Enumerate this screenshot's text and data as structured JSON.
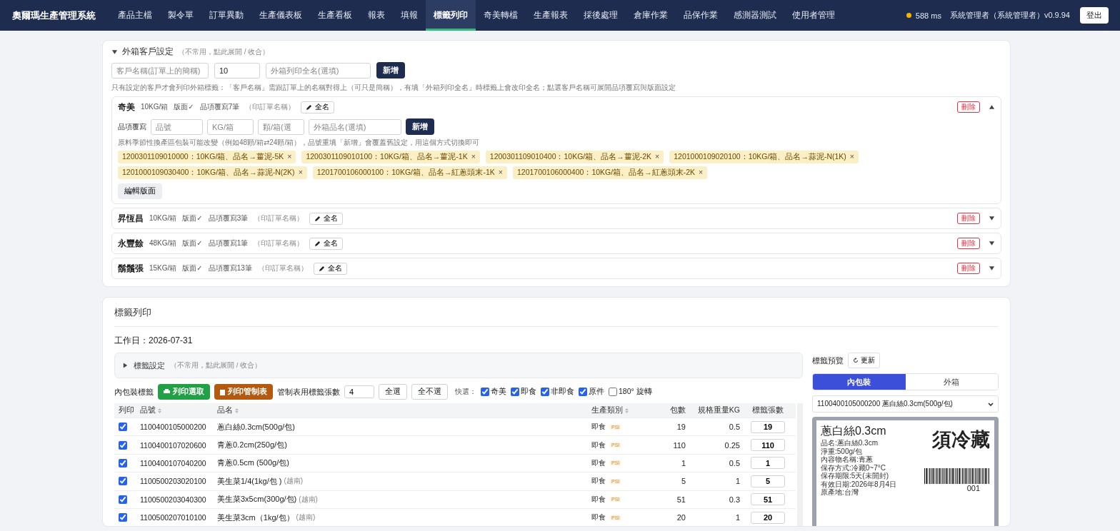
{
  "app": {
    "title": "奧爾瑪生產管理系統"
  },
  "nav": [
    {
      "label": "產品主檔",
      "selected": false
    },
    {
      "label": "製令單",
      "selected": false
    },
    {
      "label": "訂單異動",
      "selected": false
    },
    {
      "label": "生產儀表板",
      "selected": false
    },
    {
      "label": "生產看板",
      "selected": false
    },
    {
      "label": "報表",
      "selected": false
    },
    {
      "label": "填報",
      "selected": false
    },
    {
      "label": "標籤列印",
      "selected": true
    },
    {
      "label": "奇美轉檔",
      "selected": false
    },
    {
      "label": "生產報表",
      "selected": false
    },
    {
      "label": "採後處理",
      "selected": false
    },
    {
      "label": "倉庫作業",
      "selected": false
    },
    {
      "label": "品保作業",
      "selected": false
    },
    {
      "label": "感測器測試",
      "selected": false
    },
    {
      "label": "使用者管理",
      "selected": false
    }
  ],
  "status": {
    "latency": "588 ms",
    "color": "#f5b400",
    "user": "系統管理者（系統管理者）v0.9.94",
    "logout": "登出"
  },
  "carton_settings": {
    "expanded": true,
    "title": "外箱客戶設定",
    "hint": "（不常用，點此展開 / 收合）",
    "fields": [
      {
        "placeholder": "客戶名稱(訂單上的簡稱)"
      },
      {
        "value": "10"
      },
      {
        "placeholder": "外箱列印全名(選填)"
      }
    ],
    "add_button": "新增",
    "note": "只有設定的客戶才會列印外箱標籤：「客戶名稱」需跟訂單上的名稱對得上（可只是簡稱），有填「外箱列印全名」時標籤上會改印全名；點選客戶名稱可展開品項覆寫與版面設定",
    "customers": [
      {
        "name": "奇美",
        "weight": "10KG/箱",
        "layout": "版面✓",
        "overrides": "品項覆寫7筆",
        "print_name": "（印訂單名稱）",
        "fullname_button": "全名",
        "delete_button": "刪除",
        "expanded": true,
        "override_label": "品項覆寫",
        "override_fields": [
          {
            "placeholder": "品號"
          },
          {
            "placeholder": "KG/箱"
          },
          {
            "placeholder": "顆/箱(選"
          },
          {
            "placeholder": "外箱品名(選填)"
          }
        ],
        "add_button": "新增",
        "note": "原料季節性換產區包裝可能改變（例如48顆/箱⇄24顆/箱），品號重填「新增」會覆蓋舊設定，用這個方式切換即可",
        "chips": [
          {
            "text": "1200301109010000：10KG/箱、品名→薑泥-5K",
            "remove": "×"
          },
          {
            "text": "1200301109010100：10KG/箱、品名→薑泥-1K",
            "remove": "×"
          },
          {
            "text": "1200301109010400：10KG/箱、品名→薑泥-2K",
            "remove": "×"
          },
          {
            "text": "1201000109020100：10KG/箱、品名→蒜泥-N(1K)",
            "remove": "×"
          },
          {
            "text": "1201000109030400：10KG/箱、品名→蒜泥-N(2K)",
            "remove": "×"
          },
          {
            "text": "1201700106000100：10KG/箱、品名→紅蔥頭末-1K",
            "remove": "×"
          },
          {
            "text": "1201700106000400：10KG/箱、品名→紅蔥頭末-2K",
            "remove": "×"
          }
        ],
        "edit_layout_button": "編輯版面"
      },
      {
        "name": "昇恆昌",
        "weight": "10KG/箱",
        "layout": "版面✓",
        "overrides": "品項覆寫3筆",
        "print_name": "（印訂單名稱）",
        "fullname_button": "全名",
        "delete_button": "刪除",
        "expanded": false
      },
      {
        "name": "永豐餘",
        "weight": "48KG/箱",
        "layout": "版面✓",
        "overrides": "品項覆寫1筆",
        "print_name": "（印訂單名稱）",
        "fullname_button": "全名",
        "delete_button": "刪除",
        "expanded": false
      },
      {
        "name": "鬍鬚張",
        "weight": "15KG/箱",
        "layout": "版面✓",
        "overrides": "品項覆寫13筆",
        "print_name": "（印訂單名稱）",
        "fullname_button": "全名",
        "delete_button": "刪除",
        "expanded": false
      }
    ]
  },
  "label_print": {
    "title": "標籤列印",
    "work_date": "工作日：2026-07-31",
    "settings": {
      "expanded": false,
      "title": "標籤設定",
      "hint": "（不常用，點此展開 / 收合）"
    },
    "toolbar": {
      "label": "內包裝標籤",
      "print_selected": "列印選取",
      "print_control": "列印管制表",
      "count_label": "管制表用標籤張數",
      "count_value": "4",
      "select_all": "全選",
      "select_none": "全不選",
      "quick_label": "快選：",
      "filters": [
        {
          "label": "奇美",
          "checked": true
        },
        {
          "label": "即食",
          "checked": true
        },
        {
          "label": "非即食",
          "checked": true
        },
        {
          "label": "原件",
          "checked": true
        }
      ],
      "rotate": {
        "label": "180° 旋轉",
        "checked": false
      }
    },
    "table": {
      "columns": [
        {
          "label": "列印",
          "sortable": false
        },
        {
          "label": "品號",
          "sortable": true
        },
        {
          "label": "品名",
          "sortable": true
        },
        {
          "label": "生產類別",
          "sortable": true
        },
        {
          "label": "包數",
          "sortable": false
        },
        {
          "label": "規格重量KG",
          "sortable": false
        },
        {
          "label": "標籤張數",
          "sortable": false
        }
      ],
      "rows": [
        {
          "print": true,
          "code": "1100400105000200",
          "name": "蔥白絲0.3cm(500g/包)",
          "category": "即食",
          "tag": "PSI",
          "packs": "19",
          "weight": "0.5",
          "count": "19"
        },
        {
          "print": true,
          "code": "1100400107020600",
          "name": "青蔥0.2cm(250g/包)",
          "category": "即食",
          "tag": "PSI",
          "packs": "110",
          "weight": "0.25",
          "count": "110"
        },
        {
          "print": true,
          "code": "1100400107040200",
          "name": "青蔥0.5cm (500g/包)",
          "category": "即食",
          "tag": "PSI",
          "packs": "1",
          "weight": "0.5",
          "count": "1"
        },
        {
          "print": true,
          "code": "1100500203020100",
          "name": "美生菜1/4(1kg/包 )",
          "origin": "(越南)",
          "category": "即食",
          "tag": "PSI",
          "packs": "5",
          "weight": "1",
          "count": "5"
        },
        {
          "print": true,
          "code": "1100500203040300",
          "name": "美生菜3x5cm(300g/包)",
          "origin": "(越南)",
          "category": "即食",
          "tag": "PSI",
          "packs": "51",
          "weight": "0.3",
          "count": "51"
        },
        {
          "print": true,
          "code": "1100500207010100",
          "name": "美生菜3cm（1kg/包）",
          "origin": "(越南)",
          "category": "即食",
          "tag": "PSI",
          "packs": "20",
          "weight": "1",
          "count": "20"
        }
      ]
    }
  },
  "preview": {
    "title": "標籤預覽",
    "refresh": "更新",
    "tabs": [
      {
        "label": "內包裝",
        "selected": true
      },
      {
        "label": "外箱",
        "selected": false
      }
    ],
    "select_value": "1100400105000200 蔥白絲0.3cm(500g/包)",
    "label": {
      "name": "蔥白絲0.3cm",
      "lines": [
        "品名:蔥白絲0.3cm",
        "淨重:500g/包",
        "內容物名稱:青蔥",
        "保存方式:冷藏0~7°C",
        "保存期限:5天(未開封)",
        "有效日期:2026年8月4日",
        "原產地:台灣"
      ],
      "warning": "須冷藏",
      "serial": "001"
    }
  }
}
